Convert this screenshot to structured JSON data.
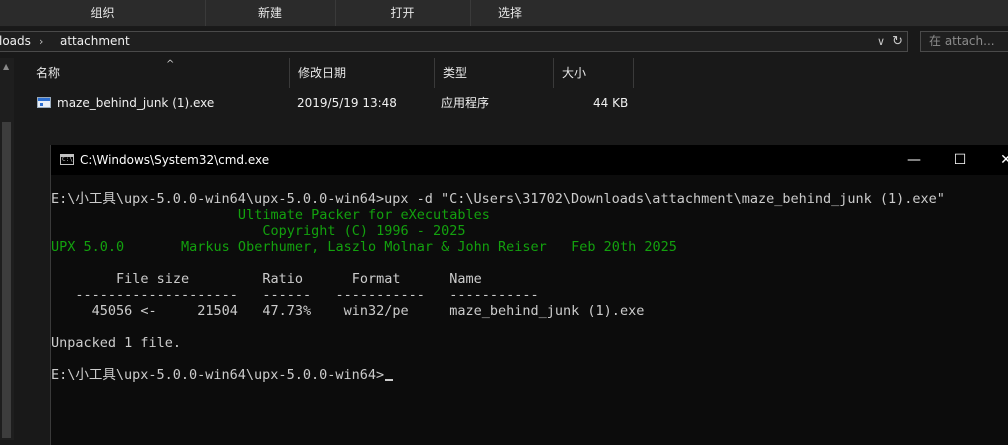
{
  "explorer": {
    "ribbon": [
      "组织",
      "新建",
      "打开",
      "选择"
    ],
    "address": {
      "crumbs": [
        "loads",
        "attachment"
      ],
      "search_placeholder": "在 attach..."
    },
    "columns": {
      "name": "名称",
      "modified": "修改日期",
      "type": "类型",
      "size": "大小"
    },
    "files": [
      {
        "name": "maze_behind_junk (1).exe",
        "modified": "2019/5/19 13:48",
        "type": "应用程序",
        "size": "44 KB"
      }
    ]
  },
  "cmd": {
    "title": "C:\\Windows\\System32\\cmd.exe",
    "controls": {
      "minimize": "—",
      "maximize": "☐",
      "close": "✕"
    },
    "lines": {
      "command": "E:\\小工具\\upx-5.0.0-win64\\upx-5.0.0-win64>upx -d \"C:\\Users\\31702\\Downloads\\attachment\\maze_behind_junk (1).exe\"",
      "banner1": "                       Ultimate Packer for eXecutables",
      "banner2": "                          Copyright (C) 1996 - 2025",
      "banner3": "UPX 5.0.0       Markus Oberhumer, Laszlo Molnar & John Reiser   Feb 20th 2025",
      "table_header": "        File size         Ratio      Format      Name",
      "table_rule": "   --------------------   ------   -----------   -----------",
      "table_row": "     45056 <-     21504   47.73%    win32/pe     maze_behind_junk (1).exe",
      "result": "Unpacked 1 file.",
      "prompt": "E:\\小工具\\upx-5.0.0-win64\\upx-5.0.0-win64>"
    }
  }
}
